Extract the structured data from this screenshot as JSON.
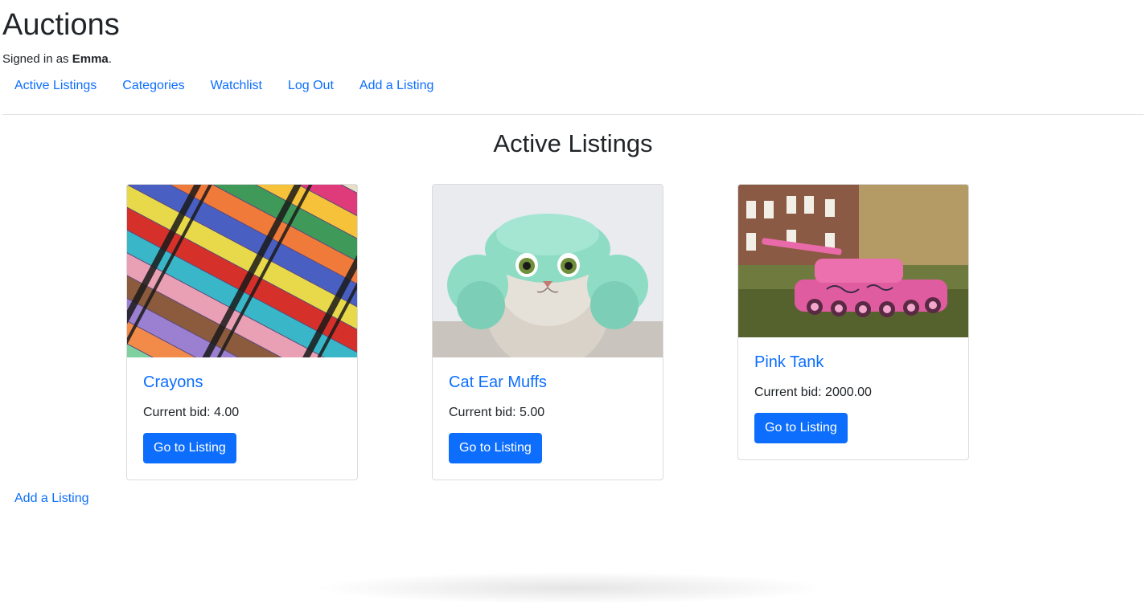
{
  "header": {
    "site_title": "Auctions",
    "signed_in_prefix": "Signed in as ",
    "username": "Emma",
    "signed_in_suffix": "."
  },
  "nav": {
    "items": [
      {
        "label": "Active Listings"
      },
      {
        "label": "Categories"
      },
      {
        "label": "Watchlist"
      },
      {
        "label": "Log Out"
      },
      {
        "label": "Add a Listing"
      }
    ]
  },
  "main": {
    "heading": "Active Listings",
    "listings": [
      {
        "title": "Crayons",
        "bid_label": "Current bid: 4.00",
        "button_label": "Go to Listing",
        "image": "crayons-photo"
      },
      {
        "title": "Cat Ear Muffs",
        "bid_label": "Current bid: 5.00",
        "button_label": "Go to Listing",
        "image": "cat-ear-muffs-photo"
      },
      {
        "title": "Pink Tank",
        "bid_label": "Current bid: 2000.00",
        "button_label": "Go to Listing",
        "image": "pink-tank-photo"
      }
    ]
  },
  "footer": {
    "add_listing_label": "Add a Listing"
  },
  "colors": {
    "link": "#0d6efd",
    "button_bg": "#0d6efd",
    "text": "#212529",
    "divider": "#dee2e6"
  }
}
